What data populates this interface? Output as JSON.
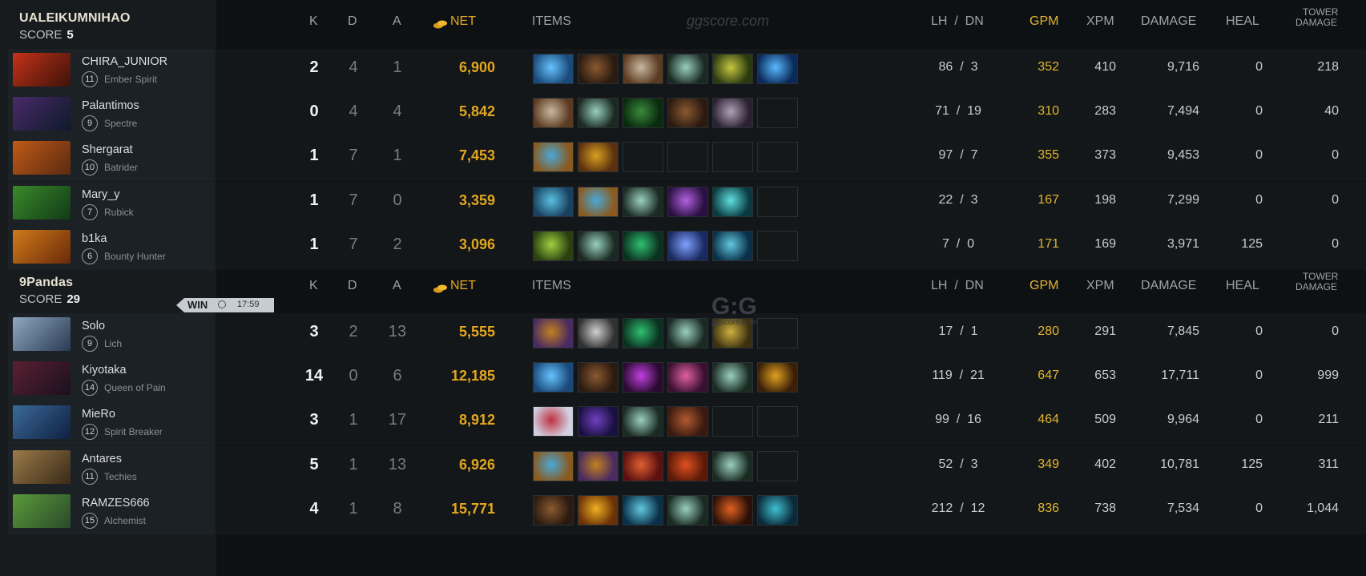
{
  "colors": {
    "net": "#e3a71f",
    "gpm": "#e3b52c",
    "kills": "#f1f1f1",
    "muted": "#777c80"
  },
  "watermarks": {
    "top": "ggscore.com",
    "bottom_logo": "G:G",
    "bottom_sub": "ggscore.com"
  },
  "headers": {
    "k": "K",
    "d": "D",
    "a": "A",
    "net": "NET",
    "items": "ITEMS",
    "lh_dn": "LH  /  DN",
    "gpm": "GPM",
    "xpm": "XPM",
    "damage": "DAMAGE",
    "heal": "HEAL",
    "tower_l1": "TOWER",
    "tower_l2": "DAMAGE"
  },
  "teams": [
    {
      "name": "UALEIKUMNIHAO",
      "score_label": "SCORE",
      "score": "5",
      "players": [
        {
          "name": "CHIRA_JUNIOR",
          "level": "11",
          "hero": "Ember Spirit",
          "k": "2",
          "d": "4",
          "a": "1",
          "net": "6,900",
          "lh": "86",
          "dn": "3",
          "gpm": "352",
          "xpm": "410",
          "damage": "9,716",
          "heal": "0",
          "tower": "218",
          "items": [
            "gem-blue",
            "boots-brown",
            "axe",
            "sword",
            "swirl-green",
            "bolt-blue"
          ],
          "avatar": [
            "#c4321a",
            "#3c1208"
          ]
        },
        {
          "name": "Palantimos",
          "level": "9",
          "hero": "Spectre",
          "k": "0",
          "d": "4",
          "a": "4",
          "net": "5,842",
          "lh": "71",
          "dn": "19",
          "gpm": "310",
          "xpm": "283",
          "damage": "7,494",
          "heal": "0",
          "tower": "40",
          "items": [
            "axe",
            "sword",
            "mask-green",
            "boots-brown",
            "spiked-dark",
            ""
          ],
          "avatar": [
            "#4a2a6a",
            "#0e1a2a"
          ]
        },
        {
          "name": "Shergarat",
          "level": "10",
          "hero": "Batrider",
          "k": "1",
          "d": "7",
          "a": "1",
          "net": "7,453",
          "lh": "97",
          "dn": "7",
          "gpm": "355",
          "xpm": "373",
          "damage": "9,453",
          "heal": "0",
          "tower": "0",
          "items": [
            "bottle-blue",
            "helm-gold",
            "",
            "",
            "",
            ""
          ],
          "avatar": [
            "#c05a18",
            "#5a2a10"
          ]
        },
        {
          "name": "Mary_y",
          "level": "7",
          "hero": "Rubick",
          "k": "1",
          "d": "7",
          "a": "0",
          "net": "3,359",
          "lh": "22",
          "dn": "3",
          "gpm": "167",
          "xpm": "198",
          "damage": "7,299",
          "heal": "0",
          "tower": "0",
          "items": [
            "ghost-blue",
            "bottle-blue",
            "sword",
            "orb-purple",
            "flask-cyan",
            ""
          ],
          "avatar": [
            "#3a8a2a",
            "#123a18"
          ]
        },
        {
          "name": "b1ka",
          "level": "6",
          "hero": "Bounty Hunter",
          "k": "1",
          "d": "7",
          "a": "2",
          "net": "3,096",
          "lh": "7",
          "dn": "0",
          "gpm": "171",
          "xpm": "169",
          "damage": "3,971",
          "heal": "125",
          "tower": "0",
          "items": [
            "orb-green",
            "sword",
            "boots-green",
            "potion-blue",
            "swirl-cyan",
            ""
          ],
          "avatar": [
            "#d07a1a",
            "#6a2a0a"
          ]
        }
      ]
    },
    {
      "name": "9Pandas",
      "score_label": "SCORE",
      "score": "29",
      "result": "WIN",
      "duration": "17:59",
      "players": [
        {
          "name": "Solo",
          "level": "9",
          "hero": "Lich",
          "k": "3",
          "d": "2",
          "a": "13",
          "net": "5,555",
          "lh": "17",
          "dn": "1",
          "gpm": "280",
          "xpm": "291",
          "damage": "7,845",
          "heal": "0",
          "tower": "0",
          "items": [
            "horn-purple",
            "blade-silver",
            "boots-green",
            "sword",
            "skull-gold",
            ""
          ],
          "avatar": [
            "#8fa8c0",
            "#2a3a55"
          ]
        },
        {
          "name": "Kiyotaka",
          "level": "14",
          "hero": "Queen of Pain",
          "k": "14",
          "d": "0",
          "a": "6",
          "net": "12,185",
          "lh": "119",
          "dn": "21",
          "gpm": "647",
          "xpm": "653",
          "damage": "17,711",
          "heal": "0",
          "tower": "999",
          "items": [
            "gem-blue",
            "boots-brown",
            "cross-purple",
            "dagger-pink",
            "sword",
            "claw-gold"
          ],
          "avatar": [
            "#5a2030",
            "#1a1020"
          ]
        },
        {
          "name": "MieRo",
          "level": "12",
          "hero": "Spirit Breaker",
          "k": "3",
          "d": "1",
          "a": "17",
          "net": "8,912",
          "lh": "99",
          "dn": "16",
          "gpm": "464",
          "xpm": "509",
          "damage": "9,964",
          "heal": "0",
          "tower": "211",
          "items": [
            "shield-red",
            "hat-purple",
            "sword",
            "cloak-brown",
            "",
            ""
          ],
          "avatar": [
            "#3a6a9a",
            "#102040"
          ]
        },
        {
          "name": "Antares",
          "level": "11",
          "hero": "Techies",
          "k": "5",
          "d": "1",
          "a": "13",
          "net": "6,926",
          "lh": "52",
          "dn": "3",
          "gpm": "349",
          "xpm": "402",
          "damage": "10,781",
          "heal": "125",
          "tower": "311",
          "items": [
            "bottle-blue",
            "horn-purple",
            "sun-red",
            "helm-red",
            "sword",
            ""
          ],
          "avatar": [
            "#9a7a4a",
            "#3a2a18"
          ]
        },
        {
          "name": "RAMZES666",
          "level": "15",
          "hero": "Alchemist",
          "k": "4",
          "d": "1",
          "a": "8",
          "net": "15,771",
          "lh": "212",
          "dn": "12",
          "gpm": "836",
          "xpm": "738",
          "damage": "7,534",
          "heal": "0",
          "tower": "1,044",
          "items": [
            "boots-brown",
            "blade-gold",
            "swirl-cyan",
            "sword",
            "axes-red",
            "claw-cyan"
          ],
          "avatar": [
            "#5a9a3a",
            "#2a4a2a"
          ]
        }
      ]
    }
  ]
}
